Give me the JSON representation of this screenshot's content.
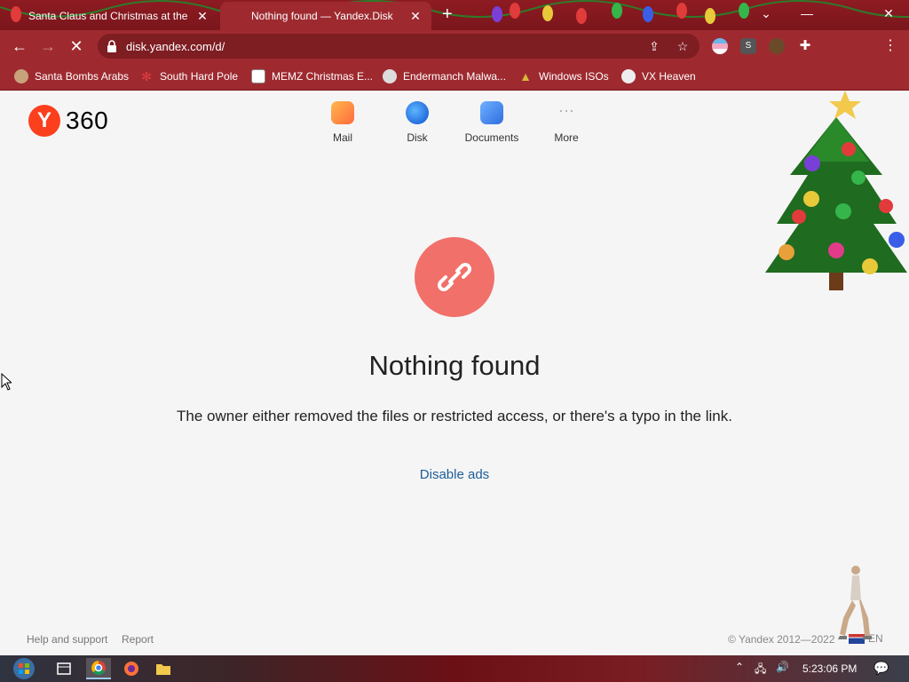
{
  "browser": {
    "tabs": [
      {
        "title": "Santa Claus and Christmas at the",
        "active": false
      },
      {
        "title": "Nothing found — Yandex.Disk",
        "active": true
      }
    ],
    "url": "disk.yandex.com/d/",
    "bookmarks": [
      {
        "label": "Santa Bombs Arabs",
        "icon": "santa-icon"
      },
      {
        "label": "South Hard Pole",
        "icon": "snowflake-icon"
      },
      {
        "label": "MEMZ Christmas E...",
        "icon": "page-icon"
      },
      {
        "label": "Endermanch Malwa...",
        "icon": "raccoon-icon"
      },
      {
        "label": "Windows ISOs",
        "icon": "tree-icon"
      },
      {
        "label": "VX Heaven",
        "icon": "skull-icon"
      }
    ]
  },
  "page": {
    "logo_text": "360",
    "services": [
      {
        "label": "Mail",
        "icon": "mail-icon"
      },
      {
        "label": "Disk",
        "icon": "disk-icon"
      },
      {
        "label": "Documents",
        "icon": "documents-icon"
      },
      {
        "label": "More",
        "icon": "more-icon"
      }
    ],
    "headline": "Nothing found",
    "description": "The owner either removed the files or restricted access, or there's a typo in the link.",
    "disable_ads": "Disable ads",
    "footer": {
      "help": "Help and support",
      "report": "Report",
      "copyright": "© Yandex 2012—2022",
      "language": "EN"
    }
  },
  "taskbar": {
    "time": "5:23:06 PM"
  },
  "colors": {
    "brand_red": "#fc3f1d",
    "error_circle": "#f1706a",
    "link_blue": "#1d5d99",
    "browser_theme": "#9e2a30"
  }
}
